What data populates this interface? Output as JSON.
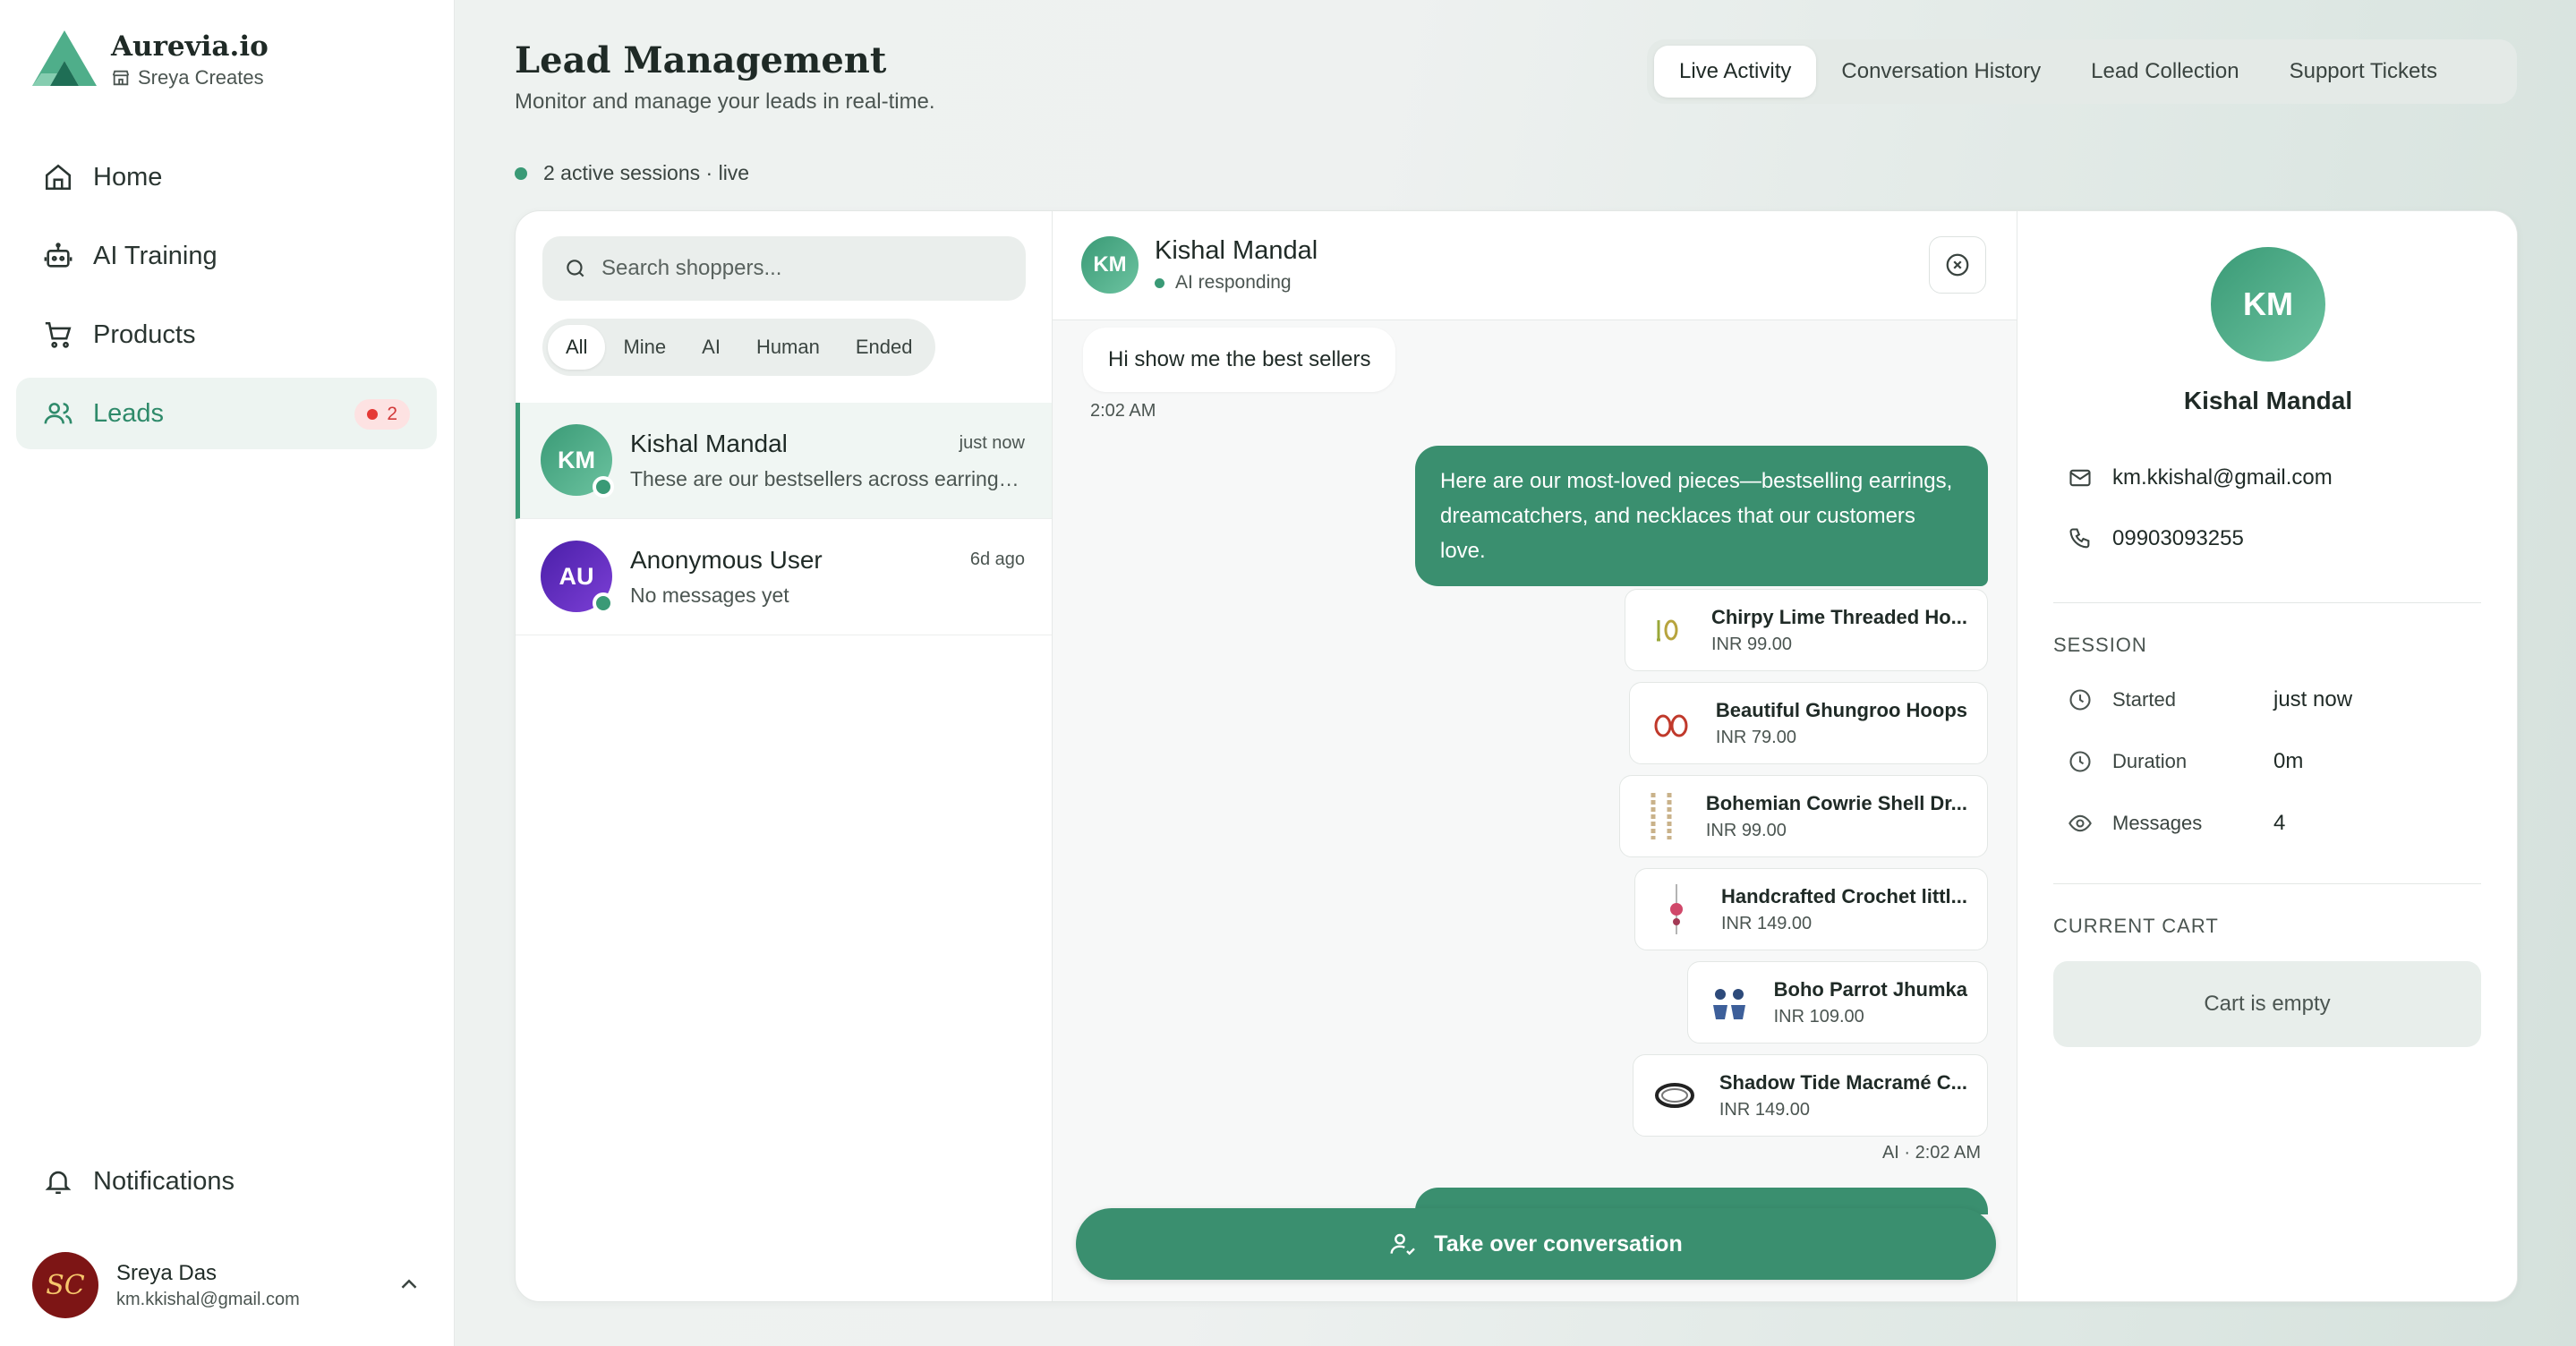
{
  "brand": {
    "name": "Aurevia.io",
    "store": "Sreya Creates"
  },
  "nav": {
    "items": [
      {
        "label": "Home",
        "icon": "home-icon"
      },
      {
        "label": "AI Training",
        "icon": "robot-icon"
      },
      {
        "label": "Products",
        "icon": "cart-icon"
      },
      {
        "label": "Leads",
        "icon": "users-icon",
        "badge": "2"
      }
    ],
    "notifications": "Notifications"
  },
  "user": {
    "name": "Sreya Das",
    "email": "km.kkishal@gmail.com",
    "initials": "SC"
  },
  "header": {
    "title": "Lead Management",
    "subtitle": "Monitor and manage your leads in real-time.",
    "sessions": "2 active sessions · live",
    "tabs": [
      "Live Activity",
      "Conversation History",
      "Lead Collection",
      "Support Tickets"
    ]
  },
  "list": {
    "search_placeholder": "Search shoppers...",
    "filters": [
      "All",
      "Mine",
      "AI",
      "Human",
      "Ended"
    ],
    "items": [
      {
        "initials": "KM",
        "name": "Kishal Mandal",
        "time": "just now",
        "preview": "These are our bestsellers across earrings, dreamcatchers and necklaces",
        "color": "#3a9a76"
      },
      {
        "initials": "AU",
        "name": "Anonymous User",
        "time": "6d ago",
        "preview": "No messages yet",
        "color": "#5b2bb5"
      }
    ]
  },
  "chat": {
    "initials": "KM",
    "name": "Kishal Mandal",
    "status": "AI responding",
    "incoming": {
      "text": "Hi show me the best sellers",
      "time": "2:02 AM"
    },
    "outgoing": {
      "text": "Here are our most-loved pieces—bestselling earrings, dreamcatchers, and necklaces that our customers love.",
      "meta": "AI · 2:02 AM"
    },
    "products": [
      {
        "title": "Chirpy Lime Threaded Ho...",
        "price": "INR 99.00"
      },
      {
        "title": "Beautiful Ghungroo Hoops",
        "price": "INR 79.00"
      },
      {
        "title": "Bohemian Cowrie Shell Dr...",
        "price": "INR 99.00"
      },
      {
        "title": "Handcrafted Crochet littl...",
        "price": "INR 149.00"
      },
      {
        "title": "Boho Parrot Jhumka",
        "price": "INR 109.00"
      },
      {
        "title": "Shadow Tide Macramé C...",
        "price": "INR 149.00"
      }
    ],
    "takeover": "Take over conversation"
  },
  "profile": {
    "initials": "KM",
    "name": "Kishal Mandal",
    "email": "km.kkishal@gmail.com",
    "phone": "09903093255",
    "session_title": "SESSION",
    "session": [
      {
        "label": "Started",
        "value": "just now"
      },
      {
        "label": "Duration",
        "value": "0m"
      },
      {
        "label": "Messages",
        "value": "4"
      }
    ],
    "cart_title": "CURRENT CART",
    "cart_empty": "Cart is empty"
  },
  "colors": {
    "accent": "#3a8f6f",
    "accent_light": "#edf4f1",
    "badge_red": "#e53935"
  }
}
